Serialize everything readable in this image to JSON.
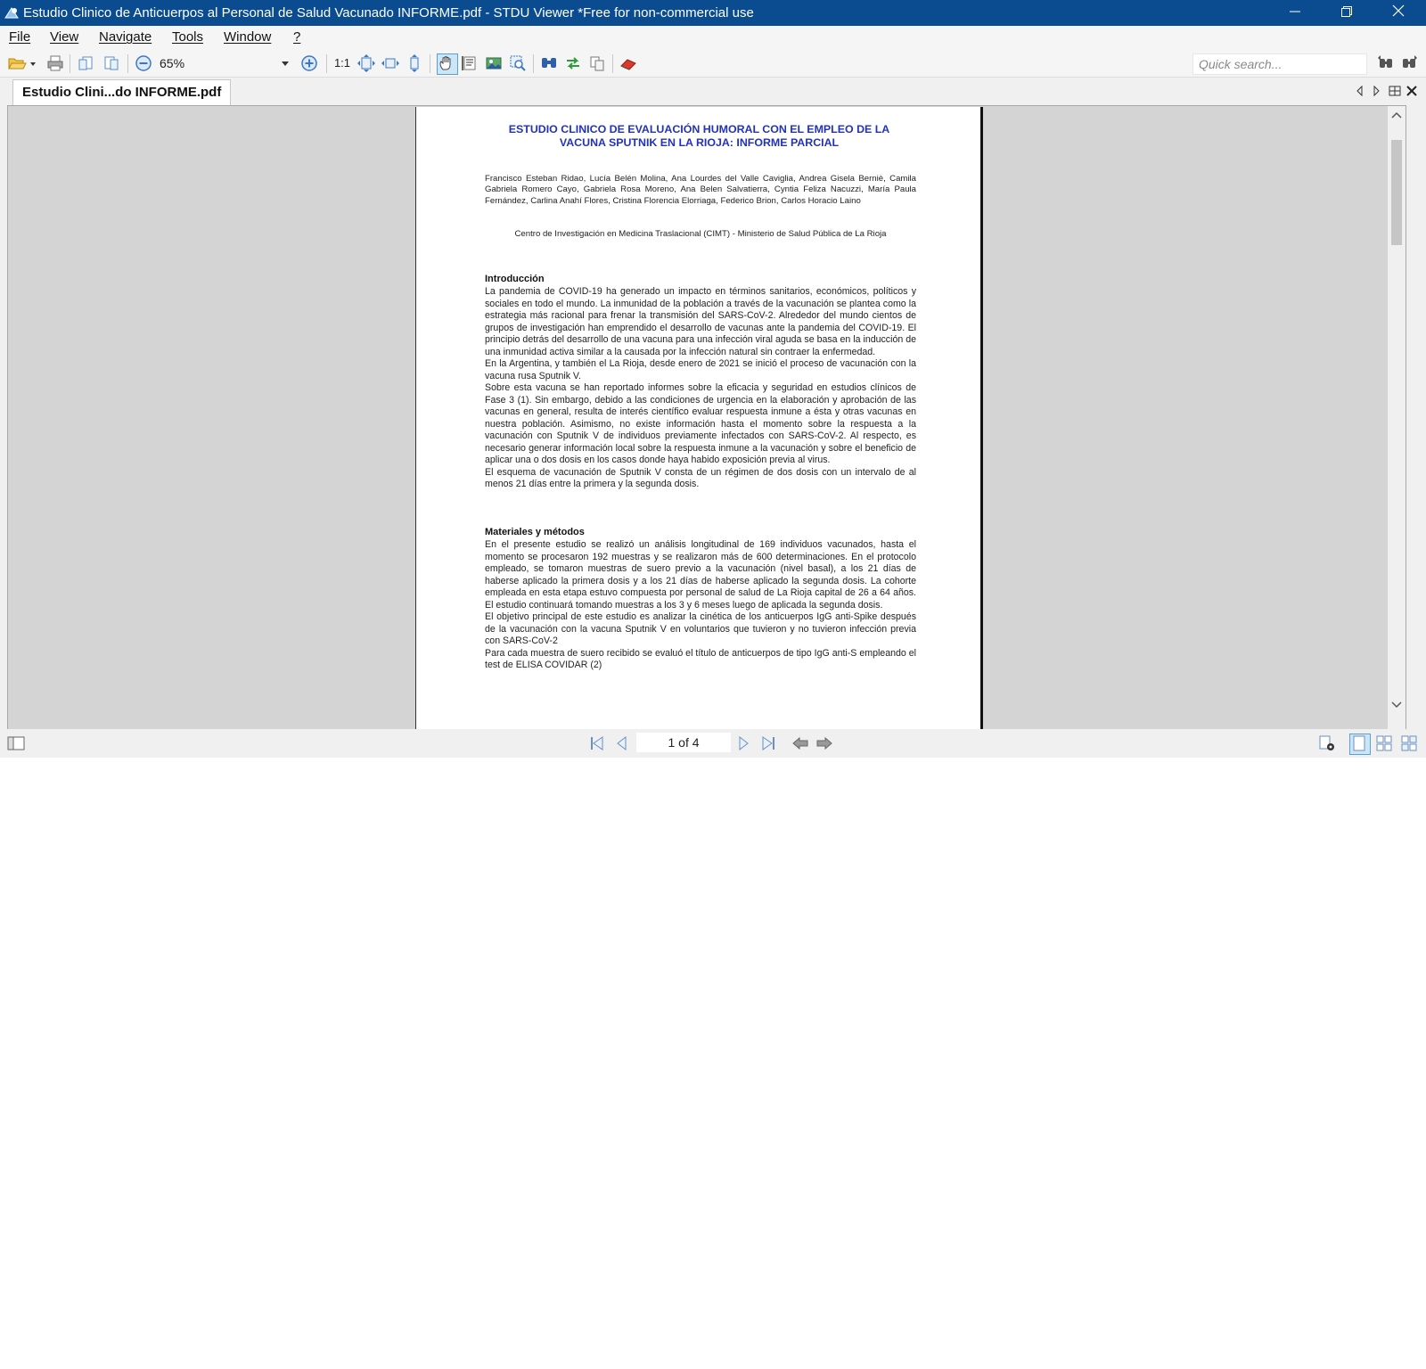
{
  "window": {
    "title": "Estudio Clinico de Anticuerpos al Personal de Salud  Vacunado INFORME.pdf - STDU Viewer *Free for non-commercial use",
    "minimize_icon": "minimize-icon",
    "restore_icon": "restore-icon",
    "close_icon": "close-icon"
  },
  "menu": [
    "File",
    "View",
    "Navigate",
    "Tools",
    "Window",
    "?"
  ],
  "toolbar": {
    "zoom_value": "65%",
    "actual_size_label": "1:1",
    "search_placeholder": "Quick search..."
  },
  "tabs": [
    {
      "label": "Estudio Clini...do INFORME.pdf",
      "active": true
    }
  ],
  "document": {
    "title_line1": "ESTUDIO CLINICO DE EVALUACIÓN HUMORAL CON EL EMPLEO DE LA",
    "title_line2": "VACUNA SPUTNIK EN LA RIOJA: INFORME PARCIAL",
    "authors": "Francisco Esteban Ridao, Lucía Belén Molina, Ana Lourdes del Valle Caviglia, Andrea Gisela Berniè, Camila Gabriela Romero Cayo, Gabriela Rosa Moreno, Ana Belen Salvatierra, Cyntia Feliza Nacuzzi, María Paula Fernández, Carlina Anahí Flores, Cristina Florencia Elorriaga, Federico Brion, Carlos Horacio Laino",
    "affiliation": "Centro de Investigación en Medicina Traslacional (CIMT) - Ministerio de Salud Pública de La Rioja",
    "section1_heading": "Introducción",
    "section1_paragraphs": [
      "La pandemia de COVID-19 ha generado un impacto en términos sanitarios, económicos, políticos y sociales en todo el mundo. La inmunidad de la población a través de la vacunación se plantea como la estrategia más racional para frenar la transmisión del SARS-CoV-2. Alrededor del mundo cientos de grupos de investigación han emprendido el desarrollo de vacunas ante la pandemia del COVID-19. El principio detrás del desarrollo de una vacuna para una infección viral aguda se basa en la inducción de una inmunidad activa similar a la causada por la infección natural sin contraer la enfermedad.",
      "En la Argentina, y también el La Rioja, desde enero de 2021 se inició el proceso de vacunación con la vacuna rusa Sputnik V.",
      "Sobre esta vacuna se han reportado informes sobre la eficacia y seguridad en estudios clínicos de Fase 3 (1). Sin embargo, debido a las condiciones de urgencia en la elaboración y aprobación de las vacunas en general, resulta de interés científico evaluar respuesta inmune a ésta y otras vacunas en nuestra población. Asimismo, no existe información hasta el momento sobre la respuesta a la vacunación con Sputnik V de individuos previamente infectados con SARS-CoV-2. Al respecto, es necesario generar información local sobre la respuesta inmune a la vacunación y sobre el beneficio de aplicar una o dos dosis en los casos donde haya habido exposición previa al virus.",
      "El esquema de vacunación de Sputnik V consta de un régimen de dos dosis con un intervalo de al menos 21 días entre la primera y la segunda dosis."
    ],
    "section2_heading": "Materiales y métodos",
    "section2_paragraphs": [
      "En el presente estudio se realizó un análisis longitudinal de 169 individuos vacunados, hasta el momento se procesaron 192 muestras y se realizaron más de 600 determinaciones. En el protocolo empleado, se tomaron muestras de suero previo a la vacunación (nivel basal), a los 21 días de haberse aplicado la primera dosis y a los 21 días de haberse aplicado la segunda dosis. La cohorte empleada en esta etapa estuvo compuesta por personal de salud de La Rioja capital de 26 a 64 años. El estudio continuará tomando muestras a los 3 y 6 meses luego de aplicada la segunda dosis.",
      "El objetivo principal de este estudio es analizar la cinética de los anticuerpos IgG anti-Spike después de la vacunación con la vacuna Sputnik V en voluntarios que tuvieron y no tuvieron infección previa con SARS-CoV-2",
      "Para cada muestra de suero recibido se evaluó el título de anticuerpos de tipo IgG anti-S empleando el test de ELISA COVIDAR (2)"
    ]
  },
  "statusbar": {
    "page_counter": "1 of 4"
  },
  "colors": {
    "titlebar": "#0a4c8f",
    "doc_title": "#2233bb",
    "viewer_bg": "#d4d4d4"
  }
}
